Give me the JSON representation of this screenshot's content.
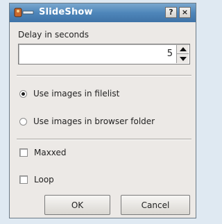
{
  "window": {
    "title": "SlideShow",
    "help_label": "?",
    "close_label": "×"
  },
  "delay": {
    "label": "Delay in seconds",
    "value": "5"
  },
  "source": {
    "option_filelist": "Use images in filelist",
    "option_browser": "Use images in browser folder",
    "selected": "filelist"
  },
  "options": {
    "maxed_label": "Maxxed",
    "maxed_checked": false,
    "loop_label": "Loop",
    "loop_checked": false
  },
  "buttons": {
    "ok_label": "OK",
    "cancel_label": "Cancel"
  },
  "icons": {
    "app": "slideshow-app-icon",
    "spin_up": "arrow-up-icon",
    "spin_down": "arrow-down-icon"
  },
  "colors": {
    "titlebar": "#4e86ba",
    "dialog_bg": "#ece9e6",
    "page_bg": "#dfe9f2"
  }
}
